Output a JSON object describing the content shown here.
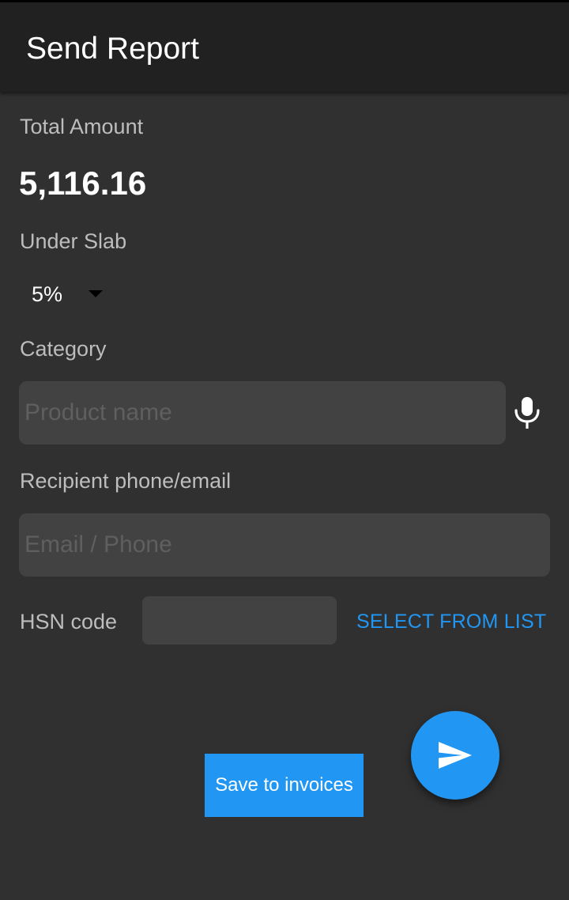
{
  "app_bar": {
    "title": "Send Report"
  },
  "total_amount": {
    "label": "Total Amount",
    "value": "5,116.16"
  },
  "under_slab": {
    "label": "Under Slab",
    "selected": "5%"
  },
  "category": {
    "label": "Category",
    "placeholder": "Product name",
    "value": ""
  },
  "recipient": {
    "label": "Recipient phone/email",
    "placeholder": "Email / Phone",
    "value": ""
  },
  "hsn": {
    "label": "HSN code",
    "value": "",
    "select_button": "SELECT FROM LIST"
  },
  "actions": {
    "save_label": "Save to invoices",
    "send_icon": "send-icon"
  },
  "colors": {
    "accent": "#2196f3",
    "background": "#303030",
    "app_bar": "#212121",
    "field": "#424242"
  }
}
